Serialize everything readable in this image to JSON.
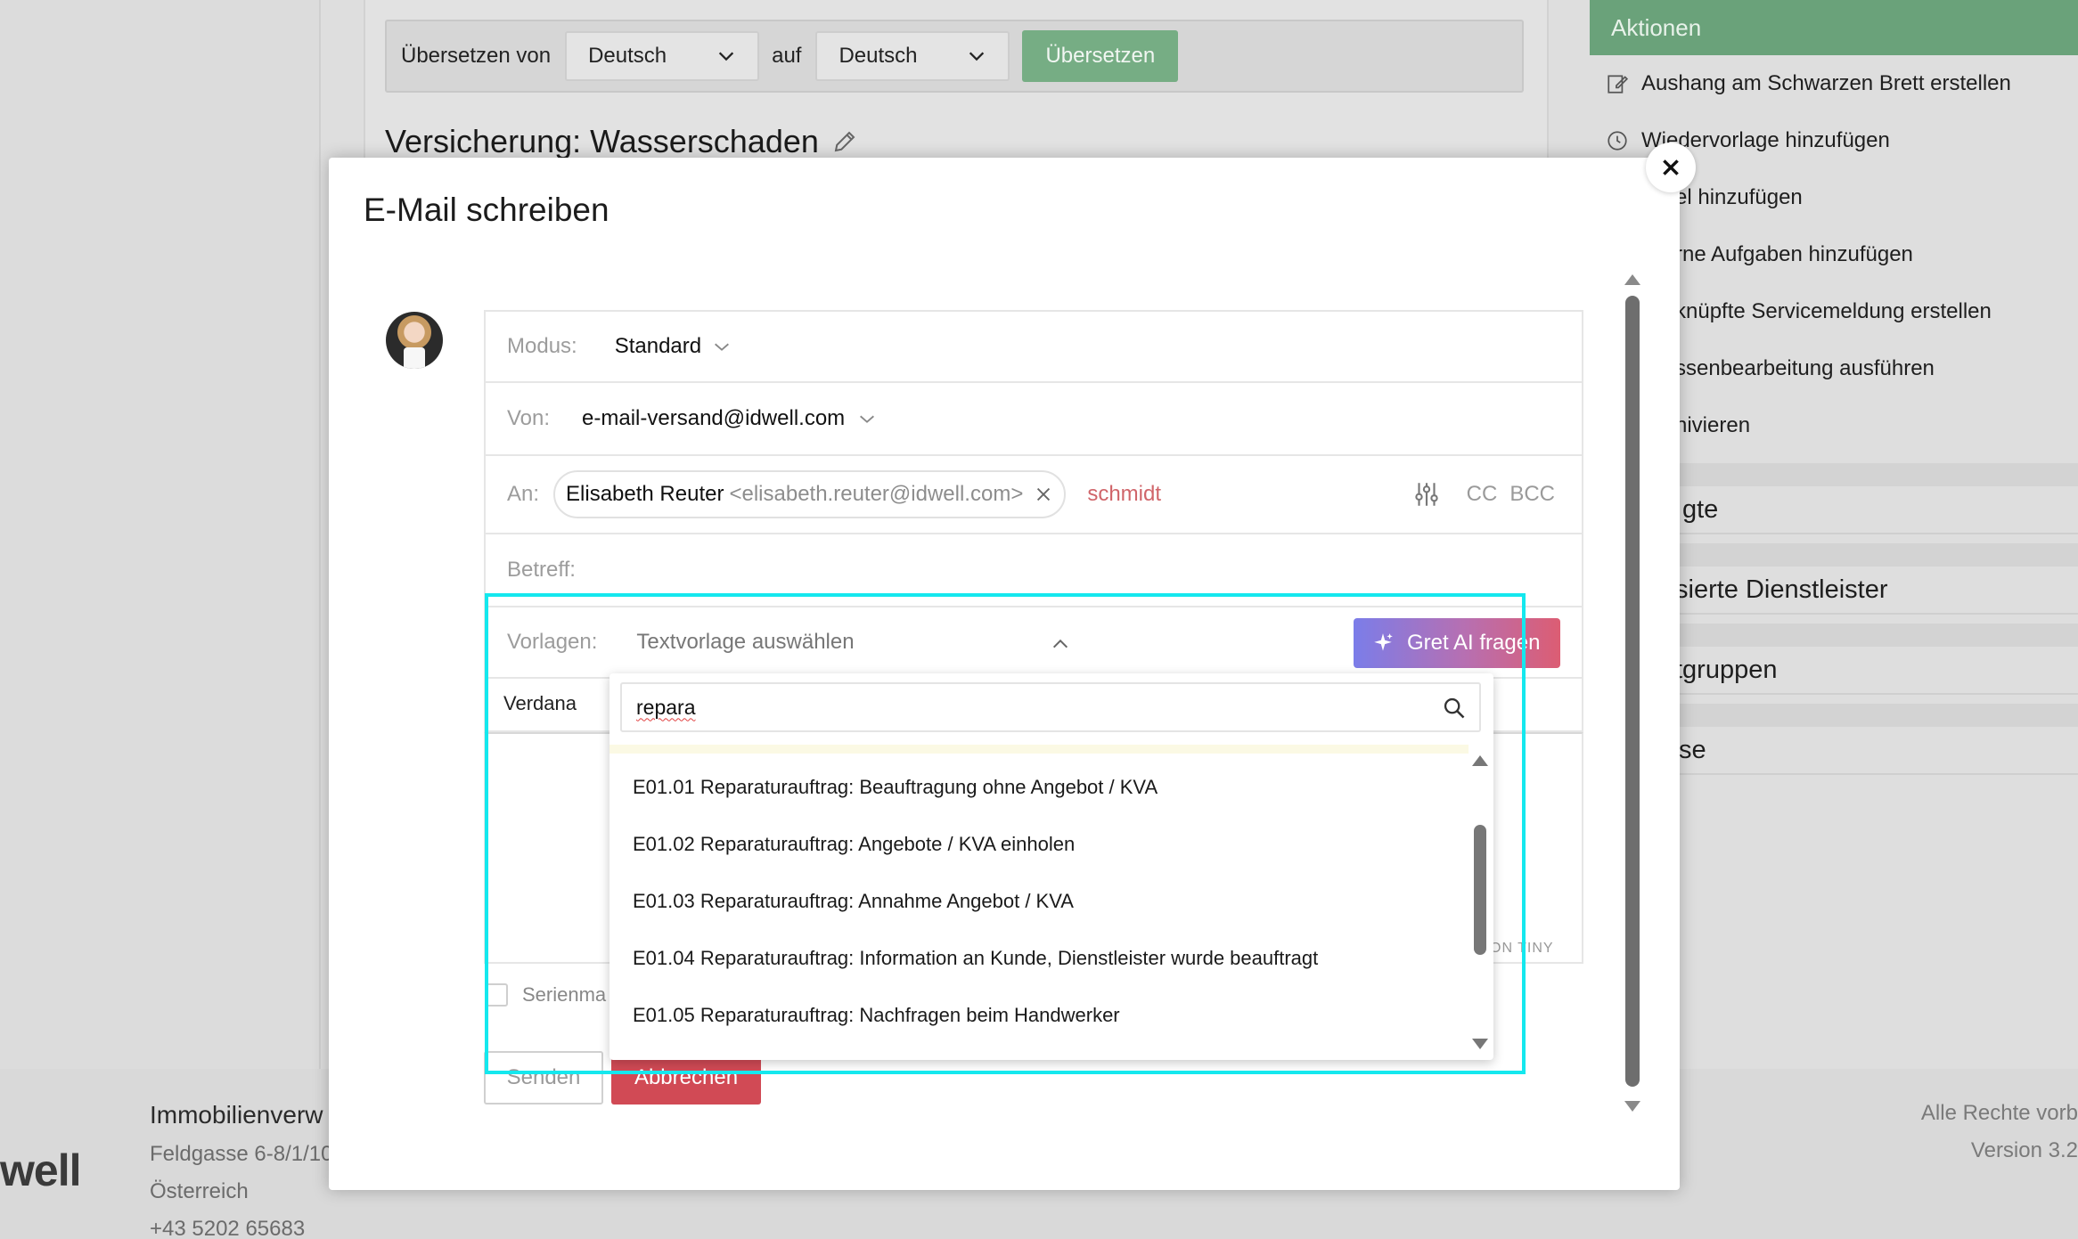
{
  "translate": {
    "from_label": "Übersetzen von",
    "from_value": "Deutsch",
    "to_label": "auf",
    "to_value": "Deutsch",
    "button": "Übersetzen"
  },
  "page_title": "Versicherung: Wasserschaden",
  "actions": {
    "header": "Aktionen",
    "items": [
      "Aushang am Schwarzen Brett erstellen",
      "Wiedervorlage hinzufügen",
      "el hinzufügen",
      "rne Aufgaben hinzufügen",
      "knüpfte Servicemeldung erstellen",
      "ssenbearbeitung ausführen",
      "nivieren"
    ],
    "sections": [
      "gte",
      "sierte Dienstleister",
      "tgruppen",
      "se"
    ]
  },
  "footer": {
    "logo": "well",
    "company": "Immobilienverw",
    "address": "Feldgasse 6-8/1/10",
    "country": "Österreich",
    "phone": "+43 5202 65683",
    "rights": "Alle Rechte vorb",
    "version": "Version 3.2"
  },
  "modal": {
    "title": "E-Mail schreiben",
    "mode_label": "Modus:",
    "mode_value": "Standard",
    "from_label": "Von:",
    "from_value": "e-mail-versand@idwell.com",
    "to_label": "An:",
    "recipient_name": "Elisabeth Reuter",
    "recipient_email": "<elisabeth.reuter@idwell.com>",
    "to_typed": "schmidt",
    "cc": "CC",
    "bcc": "BCC",
    "subject_placeholder": "Betreff:",
    "templates_label": "Vorlagen:",
    "templates_placeholder": "Textvorlage auswählen",
    "ai_button": "Gret AI fragen",
    "font": "Verdana",
    "tiny": "ON TINY",
    "serien_label": "Serienma",
    "send": "Senden",
    "cancel": "Abbrechen"
  },
  "dropdown": {
    "search_value": "repara",
    "items": [
      "E01.01 Reparaturauftrag: Beauftragung ohne Angebot / KVA",
      "E01.02 Reparaturauftrag: Angebote / KVA einholen",
      "E01.03 Reparaturauftrag: Annahme Angebot / KVA",
      "E01.04 Reparaturauftrag: Information an Kunde, Dienstleister wurde beauftragt",
      "E01.05 Reparaturauftrag: Nachfragen beim Handwerker"
    ]
  },
  "colors": {
    "accent_green": "#6aa27a",
    "cancel_red": "#d14a55",
    "highlight": "#14e8ee"
  }
}
